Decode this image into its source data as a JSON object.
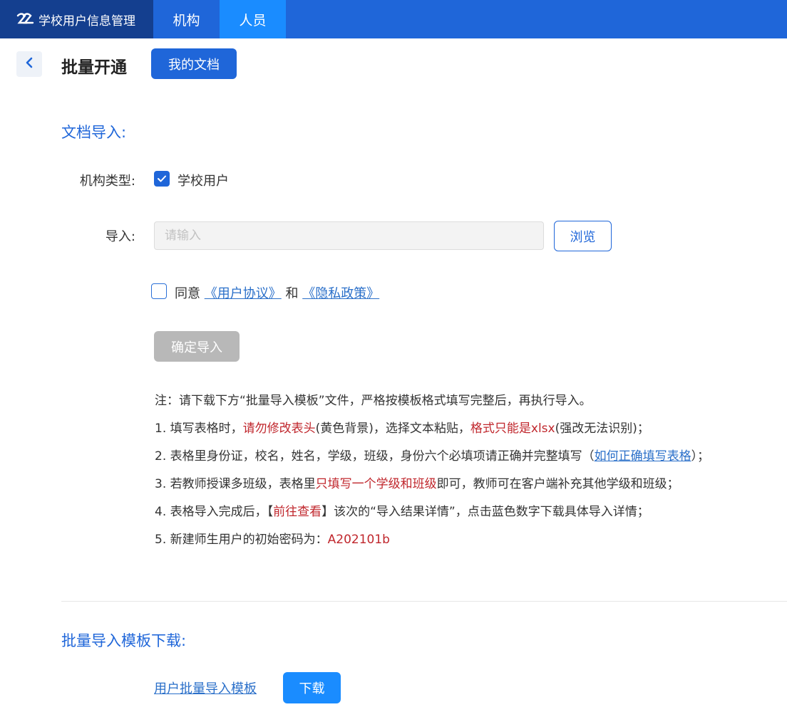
{
  "app": {
    "title": "学校用户信息管理"
  },
  "nav": {
    "tabs": [
      {
        "label": "机构"
      },
      {
        "label": "人员"
      }
    ]
  },
  "header": {
    "title": "批量开通",
    "my_docs_button": "我的文档"
  },
  "import_section": {
    "title": "文档导入:",
    "org_type_label": "机构类型:",
    "org_type_option": "学校用户",
    "import_label": "导入:",
    "import_placeholder": "请输入",
    "import_value": "",
    "browse_button": "浏览",
    "agree_prefix": "同意",
    "agreement_link": "《用户协议》",
    "agree_and": "和",
    "privacy_link": "《隐私政策》",
    "confirm_button": "确定导入"
  },
  "notes": {
    "intro": "注：请下载下方“批量导入模板”文件，严格按模板格式填写完整后，再执行导入。",
    "n1_a": "1. 填写表格时，",
    "n1_red1": "请勿修改表头",
    "n1_b": "(黄色背景)，选择文本粘贴，",
    "n1_red2": "格式只能是xlsx",
    "n1_c": "(强改无法识别)；",
    "n2_a": "2. 表格里身份证，校名，姓名，学级，班级，身份六个必填项请正确并完整填写（",
    "n2_link": "如何正确填写表格",
    "n2_b": "）；",
    "n3_a": "3. 若教师授课多班级，表格里",
    "n3_red": "只填写一个学级和班级",
    "n3_b": "即可，教师可在客户端补充其他学级和班级；",
    "n4_a": "4. 表格导入完成后，【",
    "n4_red": "前往查看",
    "n4_b": "】该次的“导入结果详情”，点击蓝色数字下载具体导入详情；",
    "n5_a": "5. 新建师生用户的初始密码为：",
    "n5_red": "A202101b"
  },
  "template_section": {
    "title": "批量导入模板下载:",
    "template_link": "用户批量导入模板",
    "download_button": "下载"
  },
  "colors": {
    "primary": "#1f66d9",
    "brand_bg": "#143f8f",
    "active_tab": "#1a8cff",
    "warning_red": "#c0272d",
    "link": "#2a6fc9"
  },
  "icons": {
    "brand": "logo-icon",
    "back": "chevron-left-icon",
    "checked": "check-icon"
  }
}
